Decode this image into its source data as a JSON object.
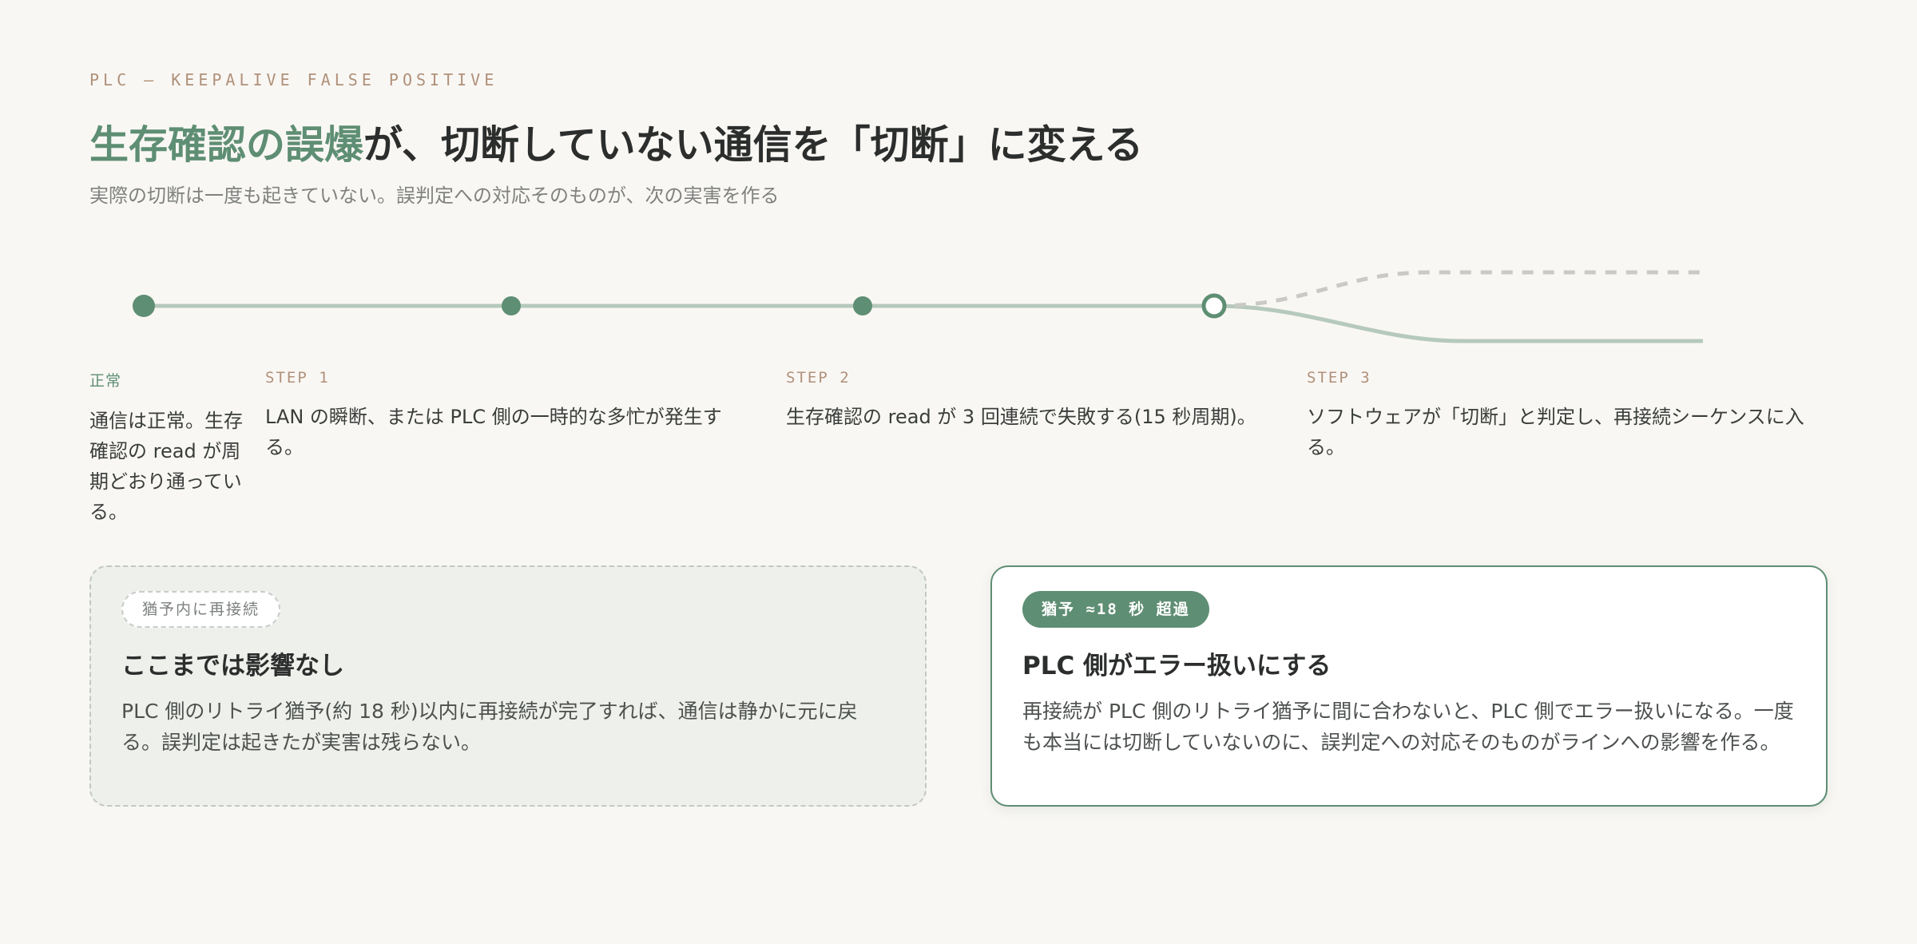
{
  "header": {
    "eyebrow": "PLC — KEEPALIVE FALSE POSITIVE",
    "title_accent": "生存確認の誤爆",
    "title_rest": "が、切断していない通信を「切断」に変える",
    "subtitle": "実際の切断は一度も起きていない。誤判定への対応そのものが、次の実害を作る"
  },
  "timeline": {
    "steps": [
      {
        "label": "正常",
        "text": "通信は正常。生存確認の read が周期どおり通っている。"
      },
      {
        "label": "STEP 1",
        "text": "LAN の瞬断、または PLC 側の一時的な多忙が発生する。"
      },
      {
        "label": "STEP 2",
        "text": "生存確認の read が 3 回連続で失敗する(15 秒周期)。"
      },
      {
        "label": "STEP 3",
        "text": "ソフトウェアが「切断」と判定し、再接続シーケンスに入る。"
      }
    ]
  },
  "outcomes": {
    "grace": {
      "badge": "猶予内に再接続",
      "title": "ここまでは影響なし",
      "body": "PLC 側のリトライ猶予(約 18 秒)以内に再接続が完了すれば、通信は静かに元に戻る。誤判定は起きたが実害は残らない。"
    },
    "error": {
      "badge": "猶予 ≈18 秒 超過",
      "title": "PLC 側がエラー扱いにする",
      "body": "再接続が PLC 側のリトライ猶予に間に合わないと、PLC 側でエラー扱いになる。一度も本当には切断していないのに、誤判定への対応そのものがラインへの影響を作る。"
    }
  },
  "colors": {
    "accent": "#5e8e73",
    "line": "#b5c9bc",
    "dashed_branch": "#c9c9c6",
    "eyebrow": "#b0917a",
    "background": "#f9f7f4"
  }
}
